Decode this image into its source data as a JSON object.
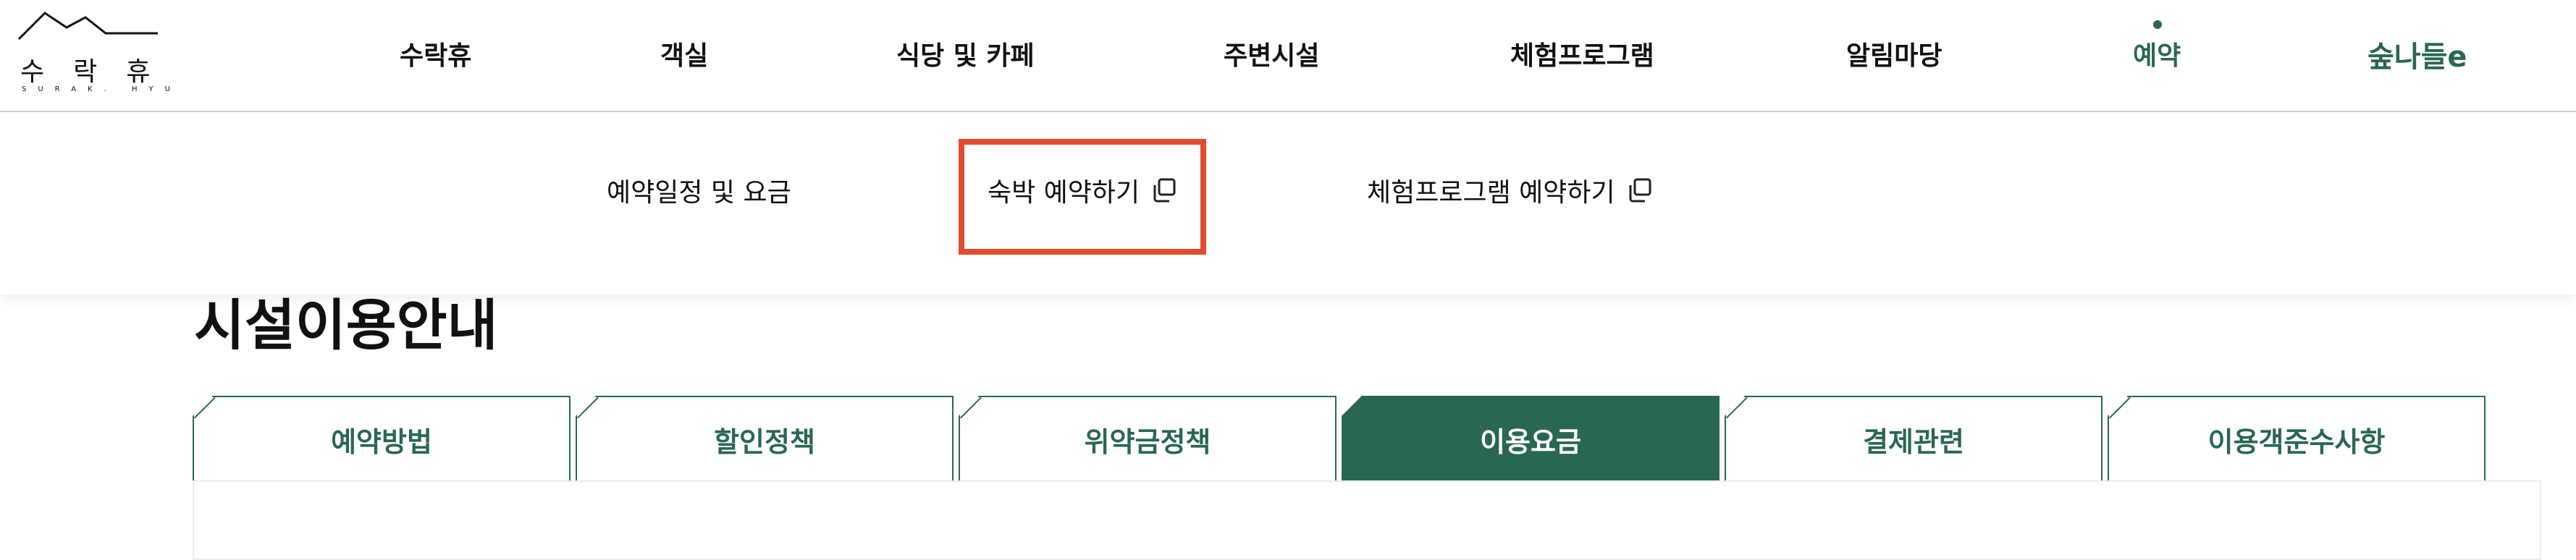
{
  "header": {
    "logo": {
      "korean": "수락휴",
      "english": "SURAK. HYU"
    },
    "nav": [
      {
        "label": "수락휴"
      },
      {
        "label": "객실"
      },
      {
        "label": "식당 및 카페"
      },
      {
        "label": "주변시설"
      },
      {
        "label": "체험프로그램"
      },
      {
        "label": "알림마당"
      },
      {
        "label": "예약",
        "active": true
      }
    ],
    "brand_logo": {
      "text": "숲나들e",
      "color": "#2a6753"
    }
  },
  "submenu": {
    "items": [
      {
        "label": "예약일정 및 요금",
        "external": false
      },
      {
        "label": "숙박 예약하기",
        "external": true,
        "highlighted": true
      },
      {
        "label": "체험프로그램 예약하기",
        "external": true
      }
    ],
    "external_icon": "external-link-icon",
    "highlight_color": "#e14b2f"
  },
  "page": {
    "title": "시설이용안내",
    "tabs": [
      {
        "label": "예약방법"
      },
      {
        "label": "할인정책"
      },
      {
        "label": "위약금정책"
      },
      {
        "label": "이용요금",
        "selected": true
      },
      {
        "label": "결제관련"
      },
      {
        "label": "이용객준수사항"
      }
    ]
  },
  "colors": {
    "accent": "#2a6753",
    "highlight": "#e14b2f",
    "text": "#111111"
  }
}
